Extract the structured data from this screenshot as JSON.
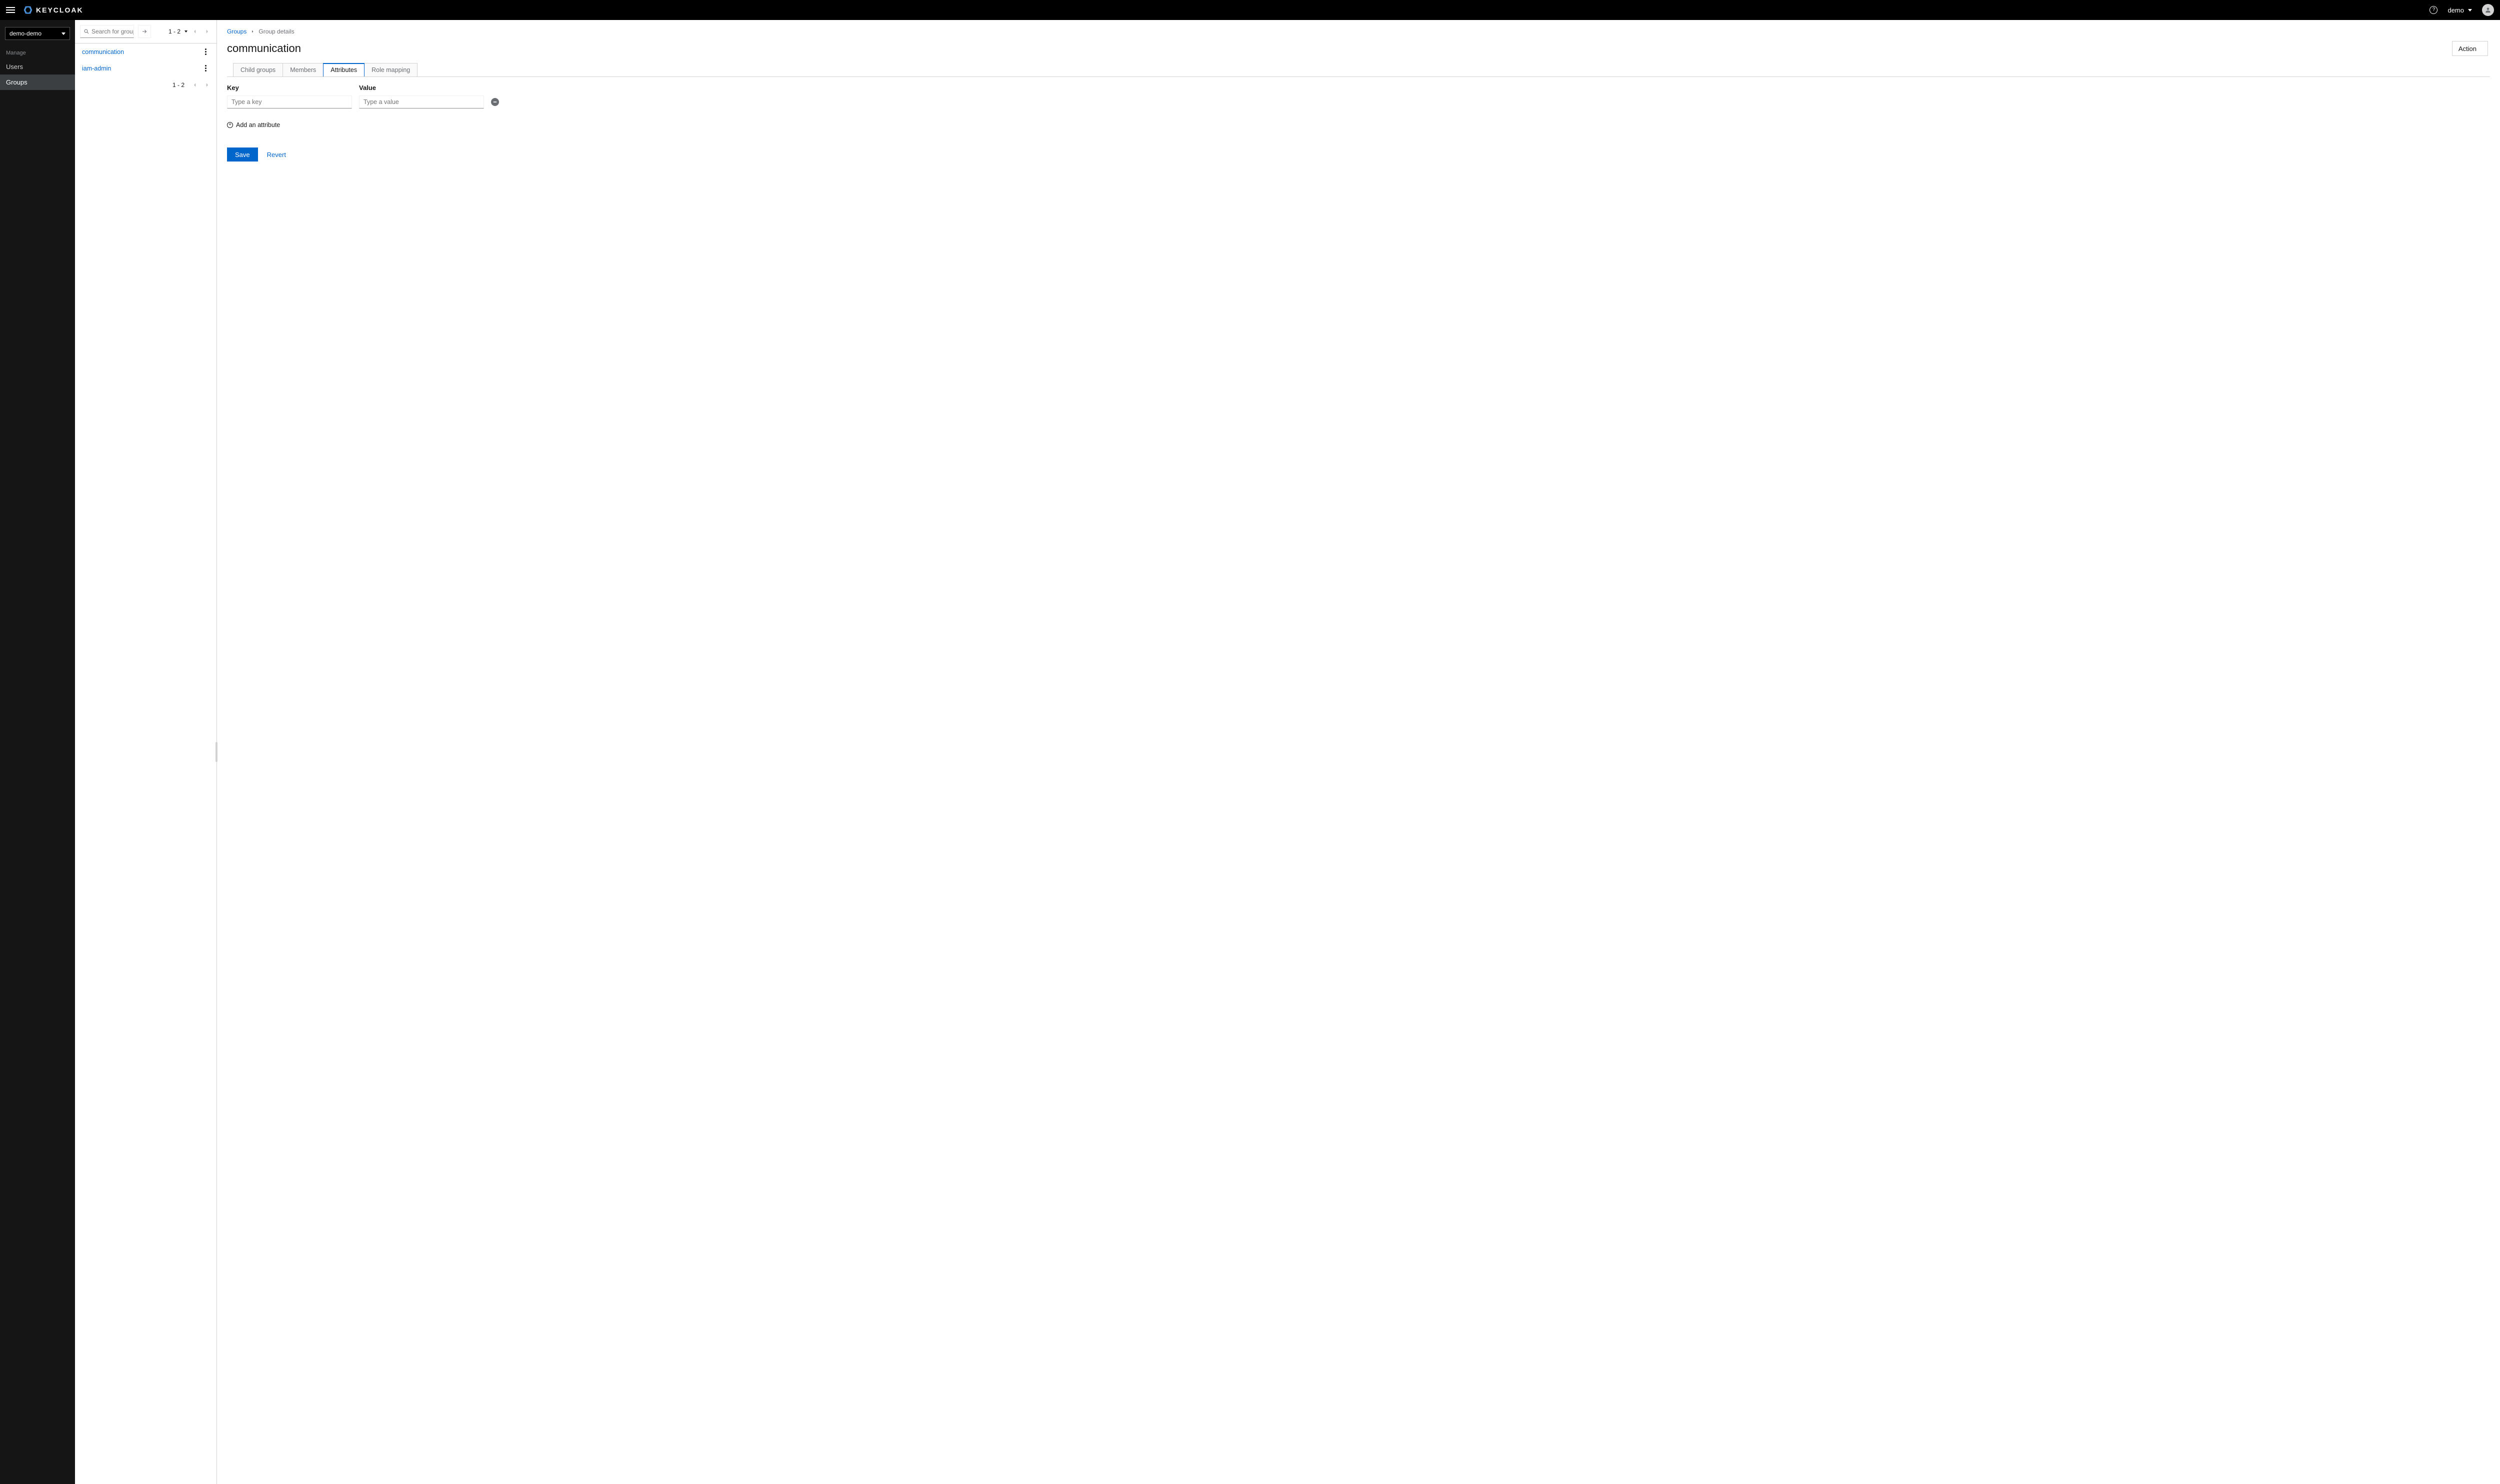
{
  "header": {
    "brand": "KEYCLOAK",
    "username": "demo"
  },
  "sidebar": {
    "realm": "demo-demo",
    "section_label": "Manage",
    "items": [
      {
        "label": "Users",
        "active": false
      },
      {
        "label": "Groups",
        "active": true
      }
    ]
  },
  "groups_panel": {
    "search_placeholder": "Search for groups",
    "page_range": "1 - 2",
    "items": [
      {
        "label": "communication"
      },
      {
        "label": "iam-admin"
      }
    ]
  },
  "breadcrumb": {
    "root": "Groups",
    "current": "Group details"
  },
  "page": {
    "title": "communication",
    "action_label": "Action"
  },
  "tabs": [
    {
      "label": "Child groups",
      "active": false
    },
    {
      "label": "Members",
      "active": false
    },
    {
      "label": "Attributes",
      "active": true
    },
    {
      "label": "Role mapping",
      "active": false
    }
  ],
  "attributes_form": {
    "key_label": "Key",
    "value_label": "Value",
    "key_placeholder": "Type a key",
    "value_placeholder": "Type a value",
    "add_label": "Add an attribute",
    "save_label": "Save",
    "revert_label": "Revert"
  }
}
